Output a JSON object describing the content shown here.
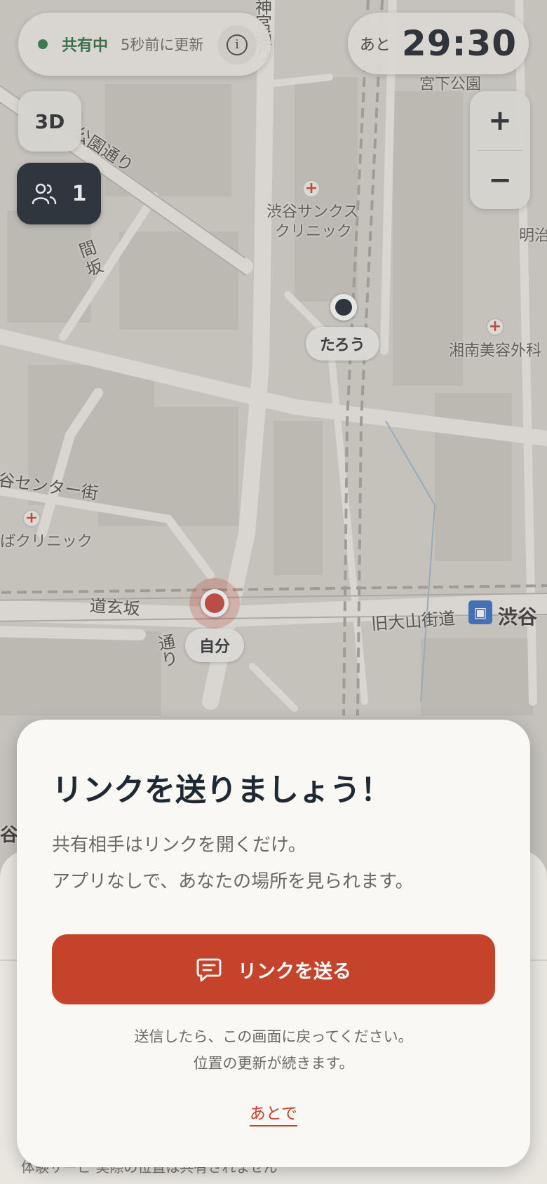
{
  "status": {
    "sharing_label": "共有中",
    "updated_label": "5秒前に更新"
  },
  "timer": {
    "prefix": "あと",
    "value": "29:30"
  },
  "controls": {
    "btn_3d": "3D",
    "people_count": "1",
    "zoom_in": "+",
    "zoom_out": "−"
  },
  "map": {
    "labels": {
      "jingu": "神宮通り",
      "miyashita": "宮下公園",
      "koen_dori": "公園通り",
      "thanks_clinic_1": "渋谷サンクス",
      "thanks_clinic_2": "クリニック",
      "meiji": "明治",
      "ma_zaka": "間坂",
      "shonan": "湘南美容外科",
      "center_gai": "谷センター街",
      "ba_clinic": "ばクリニック",
      "dogenzaka": "道玄坂",
      "kyu_oyama": "旧大山街道",
      "shibuya": "渋谷",
      "dori": "通り",
      "edge_tani": "谷"
    },
    "markers": {
      "friend": "たろう",
      "self": "自分"
    }
  },
  "sheet": {
    "title": "リンクを送りましょう！",
    "desc_line1": "共有相手はリンクを開くだけ。",
    "desc_line2": "アプリなしで、あなたの場所を見られます。",
    "send_button": "リンクを送る",
    "note_line1": "送信したら、この画面に戻ってください。",
    "note_line2": "位置の更新が続きます。",
    "later_link": "あとで"
  },
  "under": {
    "footer": "体験サービ 実際の位置は共有されません"
  },
  "colors": {
    "accent": "#c4432a",
    "dark": "#1f2933",
    "status_green": "#2f7a4a",
    "sheet_bg": "#faf8f4"
  }
}
